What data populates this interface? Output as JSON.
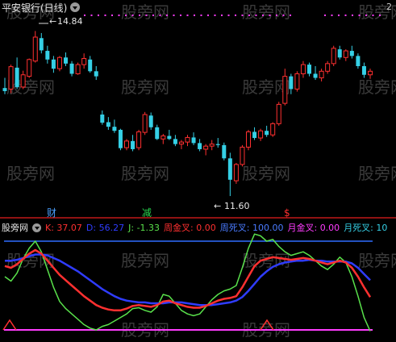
{
  "window": {
    "title": "平安银行(日线)",
    "top_right_label": "2"
  },
  "watermark": "股旁网",
  "price_panel": {
    "high_label": "14.84",
    "low_label": "11.60",
    "badges": [
      {
        "text": "财",
        "color": "#4aa0ff"
      },
      {
        "text": "减",
        "color": "#27d84f"
      },
      {
        "text": "$",
        "color": "#ff3030"
      }
    ],
    "colors": {
      "up": "#ff3030",
      "down": "#35d0e6"
    }
  },
  "indicator_panel": {
    "name": "股旁网",
    "readouts": [
      {
        "label": "K:",
        "value": "37.07",
        "color": "#ff3030"
      },
      {
        "label": "D:",
        "value": "56.27",
        "color": "#2f3cff"
      },
      {
        "label": "J:",
        "value": "-1.33",
        "color": "#59e14b"
      },
      {
        "label": "周金叉:",
        "value": "0.00",
        "color": "#ff3030"
      },
      {
        "label": "周死叉:",
        "value": "100.00",
        "color": "#4a7bff"
      },
      {
        "label": "月金叉:",
        "value": "0.00",
        "color": "#ff3cff"
      },
      {
        "label": "月死叉:",
        "value": "10",
        "color": "#35d0e6"
      }
    ]
  },
  "chart_data": [
    {
      "type": "candlestick",
      "candles": [
        [
          13.72,
          13.92,
          13.6,
          13.66
        ],
        [
          13.7,
          14.18,
          13.62,
          14.14
        ],
        [
          14.12,
          14.32,
          13.7,
          13.74
        ],
        [
          13.74,
          14.06,
          13.7,
          13.98
        ],
        [
          13.95,
          14.3,
          13.92,
          14.28
        ],
        [
          14.25,
          14.84,
          14.22,
          14.72
        ],
        [
          14.7,
          14.8,
          14.4,
          14.46
        ],
        [
          14.45,
          14.55,
          14.2,
          14.28
        ],
        [
          14.28,
          14.35,
          14.02,
          14.1
        ],
        [
          14.1,
          14.35,
          14.05,
          14.32
        ],
        [
          14.32,
          14.42,
          14.15,
          14.2
        ],
        [
          14.2,
          14.25,
          13.95,
          14.0
        ],
        [
          14.0,
          14.22,
          13.98,
          14.18
        ],
        [
          14.18,
          14.4,
          14.1,
          14.3
        ],
        [
          14.28,
          14.35,
          14.02,
          14.05
        ],
        [
          14.05,
          14.15,
          13.88,
          13.95
        ],
        [
          13.2,
          13.28,
          13.0,
          13.04
        ],
        [
          13.05,
          13.15,
          12.9,
          12.96
        ],
        [
          12.96,
          13.1,
          12.84,
          12.88
        ],
        [
          12.9,
          12.92,
          12.5,
          12.54
        ],
        [
          12.55,
          12.72,
          12.5,
          12.68
        ],
        [
          12.68,
          12.8,
          12.48,
          12.52
        ],
        [
          12.55,
          12.9,
          12.5,
          12.86
        ],
        [
          12.85,
          13.25,
          12.8,
          13.2
        ],
        [
          13.18,
          13.24,
          12.9,
          12.95
        ],
        [
          12.95,
          13.0,
          12.7,
          12.72
        ],
        [
          12.72,
          12.82,
          12.62,
          12.78
        ],
        [
          12.78,
          12.9,
          12.7,
          12.72
        ],
        [
          12.72,
          12.8,
          12.58,
          12.62
        ],
        [
          12.62,
          12.7,
          12.52,
          12.66
        ],
        [
          12.66,
          12.8,
          12.58,
          12.75
        ],
        [
          12.75,
          12.85,
          12.6,
          12.64
        ],
        [
          12.64,
          12.72,
          12.48,
          12.52
        ],
        [
          12.52,
          12.62,
          12.4,
          12.58
        ],
        [
          12.58,
          12.7,
          12.5,
          12.62
        ],
        [
          12.62,
          12.74,
          12.55,
          12.6
        ],
        [
          12.6,
          12.65,
          12.3,
          12.34
        ],
        [
          12.34,
          12.45,
          11.6,
          11.92
        ],
        [
          11.9,
          12.25,
          11.84,
          12.22
        ],
        [
          12.22,
          12.6,
          12.18,
          12.56
        ],
        [
          12.56,
          12.9,
          12.5,
          12.86
        ],
        [
          12.86,
          12.95,
          12.7,
          12.74
        ],
        [
          12.74,
          12.92,
          12.68,
          12.88
        ],
        [
          12.88,
          12.98,
          12.76,
          12.8
        ],
        [
          12.8,
          13.05,
          12.76,
          13.02
        ],
        [
          13.02,
          13.45,
          12.98,
          13.4
        ],
        [
          13.42,
          14.1,
          13.38,
          13.95
        ],
        [
          13.95,
          14.0,
          13.6,
          13.7
        ],
        [
          13.7,
          14.05,
          13.65,
          14.0
        ],
        [
          14.0,
          14.25,
          13.92,
          14.18
        ],
        [
          14.18,
          14.22,
          13.95,
          14.0
        ],
        [
          14.0,
          14.15,
          13.88,
          13.92
        ],
        [
          13.92,
          14.1,
          13.85,
          14.05
        ],
        [
          14.05,
          14.25,
          14.0,
          14.2
        ],
        [
          14.2,
          14.55,
          14.15,
          14.5
        ],
        [
          14.48,
          14.55,
          14.28,
          14.32
        ],
        [
          14.32,
          14.48,
          14.25,
          14.45
        ],
        [
          14.45,
          14.55,
          14.3,
          14.35
        ],
        [
          14.35,
          14.4,
          14.1,
          14.15
        ],
        [
          14.15,
          14.22,
          13.92,
          13.98
        ],
        [
          13.98,
          14.1,
          13.9,
          14.05
        ]
      ],
      "high_marker": "14.84",
      "low_marker": "11.60"
    },
    {
      "type": "line",
      "ylim": [
        -10,
        110
      ],
      "reference_lines": [
        100,
        0
      ],
      "series": [
        {
          "name": "K",
          "color": "#ff3030",
          "values": [
            72,
            70,
            74,
            80,
            86,
            90,
            86,
            78,
            70,
            62,
            56,
            50,
            44,
            38,
            33,
            28,
            25,
            23,
            22,
            22,
            24,
            27,
            28,
            27,
            26,
            28,
            32,
            33,
            30,
            28,
            26,
            25,
            25,
            27,
            30,
            33,
            35,
            36,
            38,
            48,
            60,
            72,
            78,
            80,
            82,
            81,
            80,
            79,
            80,
            81,
            80,
            78,
            76,
            74,
            76,
            78,
            76,
            70,
            60,
            48,
            37
          ]
        },
        {
          "name": "D",
          "color": "#2f3cff",
          "values": [
            78,
            78,
            79,
            81,
            83,
            85,
            85,
            84,
            81,
            78,
            74,
            70,
            66,
            61,
            56,
            51,
            46,
            42,
            38,
            35,
            33,
            32,
            31,
            31,
            30,
            30,
            30,
            31,
            31,
            31,
            30,
            29,
            28,
            28,
            28,
            29,
            30,
            31,
            33,
            37,
            44,
            52,
            60,
            66,
            71,
            74,
            76,
            77,
            78,
            78,
            79,
            78,
            78,
            77,
            77,
            77,
            77,
            75,
            70,
            63,
            56
          ]
        },
        {
          "name": "J",
          "color": "#59e14b",
          "values": [
            60,
            55,
            64,
            80,
            92,
            100,
            88,
            68,
            48,
            32,
            24,
            18,
            12,
            6,
            2,
            0,
            4,
            6,
            10,
            14,
            18,
            24,
            25,
            22,
            20,
            26,
            40,
            38,
            30,
            22,
            18,
            16,
            18,
            26,
            34,
            40,
            44,
            46,
            50,
            70,
            92,
            108,
            106,
            100,
            102,
            94,
            88,
            84,
            86,
            88,
            84,
            78,
            72,
            68,
            74,
            82,
            76,
            60,
            38,
            14,
            -1.33
          ]
        }
      ]
    }
  ]
}
